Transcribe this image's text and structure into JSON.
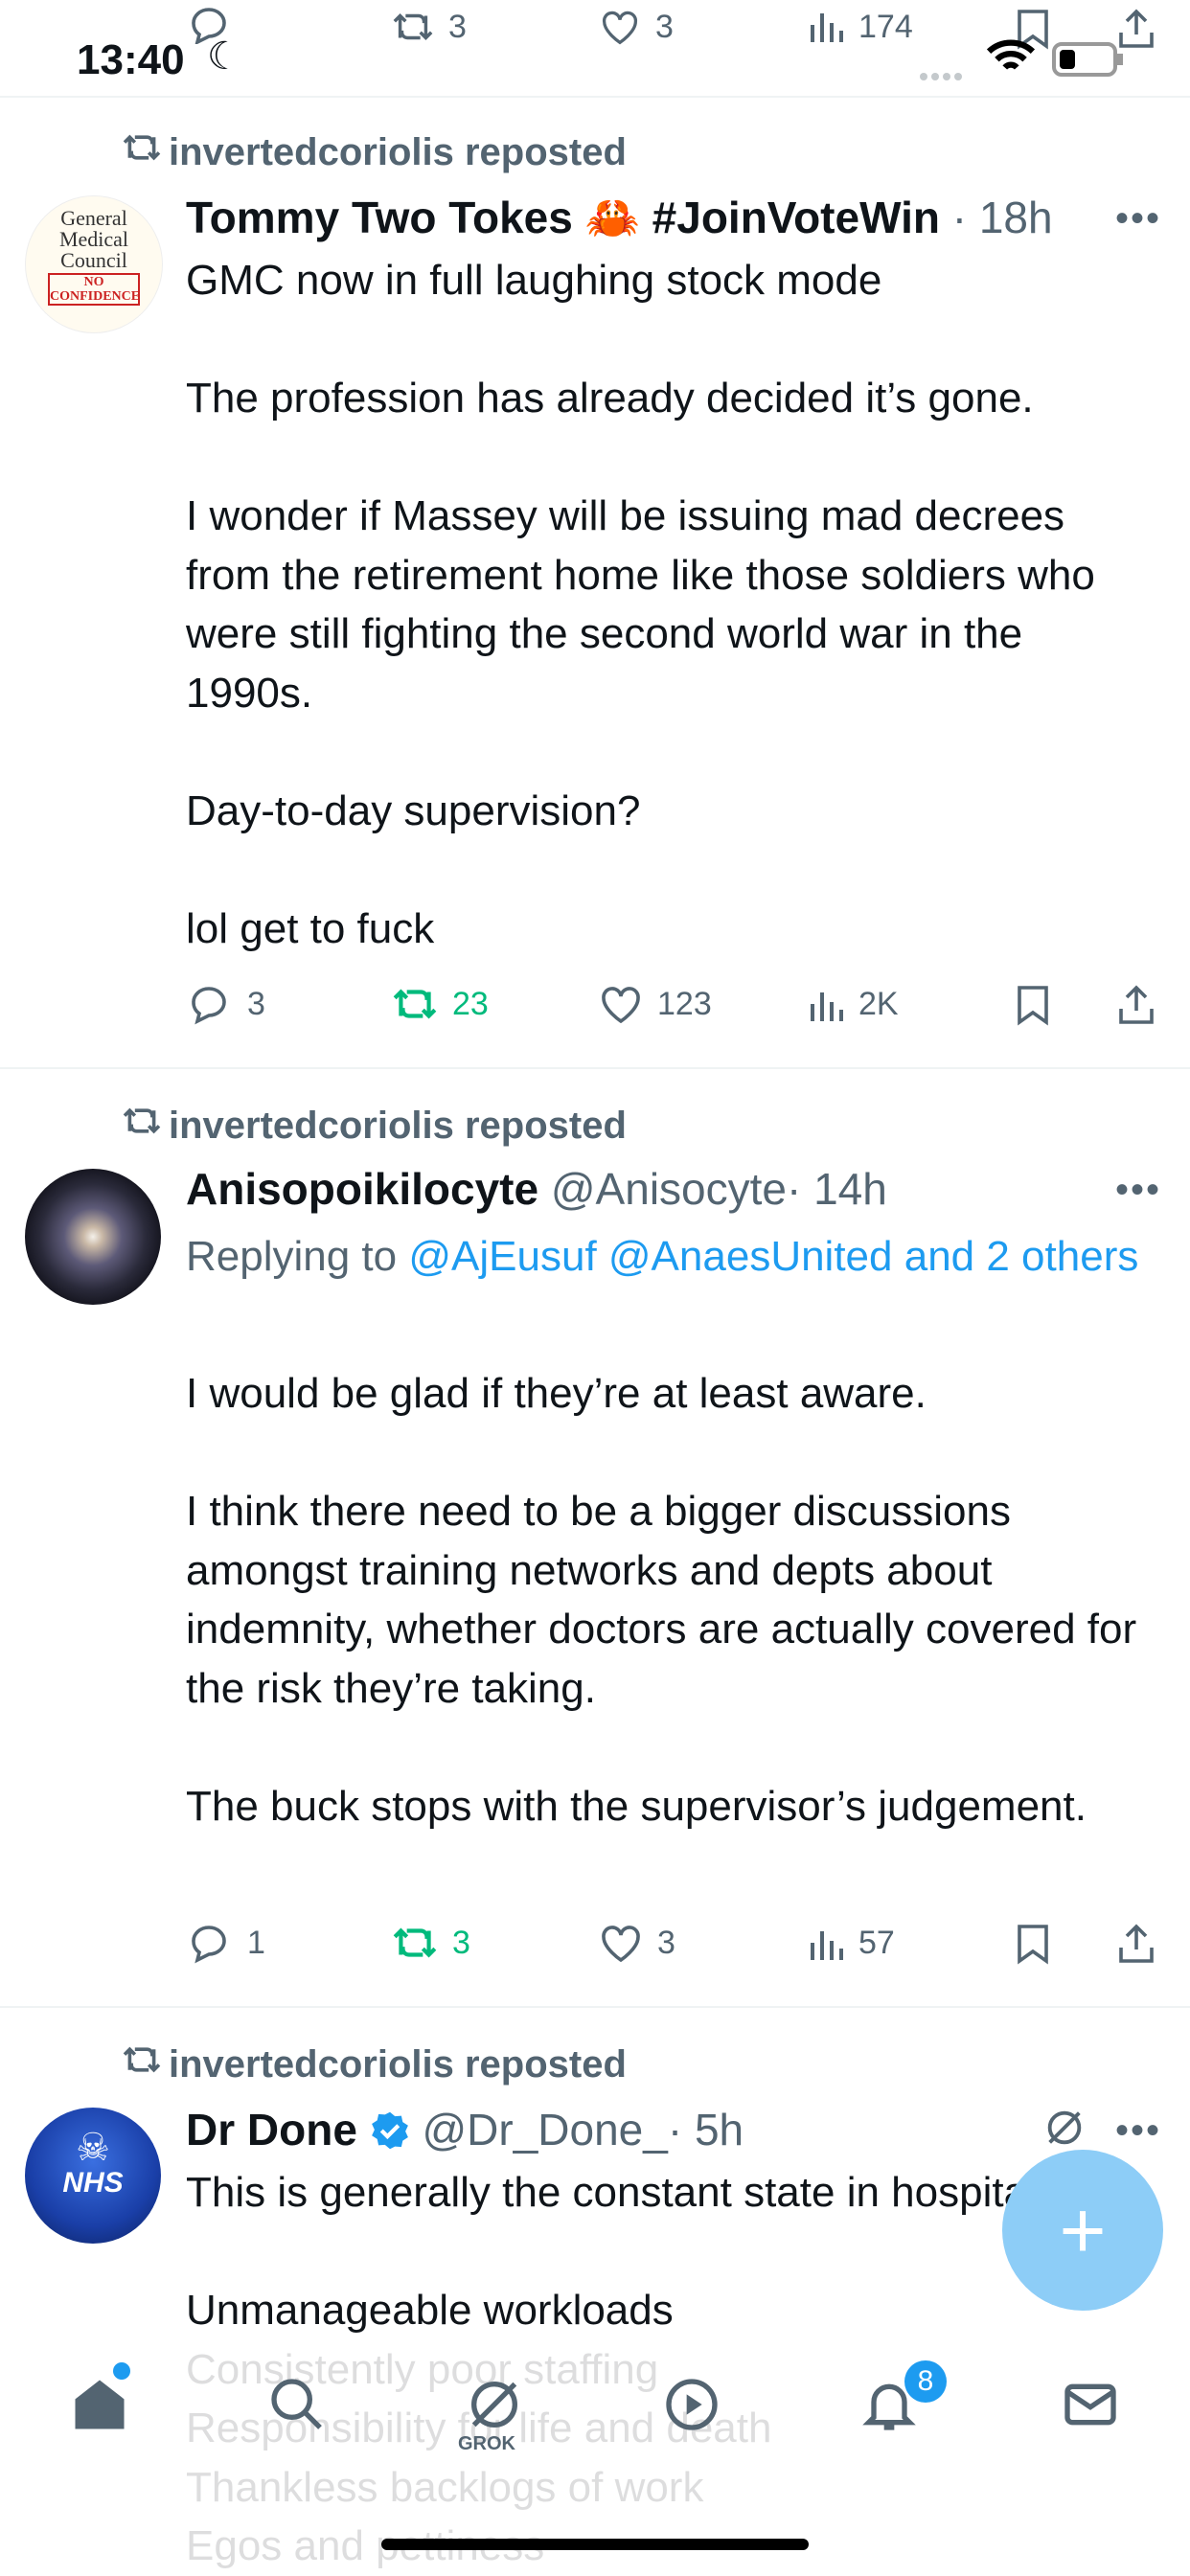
{
  "status": {
    "time": "13:40"
  },
  "prev_tweet_actions": {
    "replies": "",
    "reposts": "3",
    "likes": "3",
    "views": "174"
  },
  "tweets": [
    {
      "reposted_by": "invertedcoriolis reposted",
      "name": "Tommy Two Tokes 🦀 #JoinVoteWin",
      "handle": "",
      "time": "· 18h",
      "avatar_text": [
        "General",
        "Medical",
        "Council",
        "NO",
        "CONFIDENCE"
      ],
      "replying_to": "",
      "body": "GMC now in full laughing stock mode\n\nThe profession has already decided it’s gone.\n\nI wonder if Massey will be issuing mad decrees from the retirement home like those soldiers who were still fighting the second world war in the 1990s.\n\nDay-to-day supervision?\n\nlol get to fuck",
      "replies": "3",
      "reposts": "23",
      "likes": "123",
      "views": "2K"
    },
    {
      "reposted_by": "invertedcoriolis reposted",
      "name": "Anisopoikilocyte",
      "handle": "@Anisocyte",
      "time": "· 14h",
      "replying_prefix": "Replying to ",
      "replying_to": "@AjEusuf @AnaesUnited and 2 others",
      "body": "I would be glad if they’re at least aware.\n\nI think there need to be a bigger discussions amongst training networks and depts about indemnity, whether doctors are actually covered for the risk they’re taking.\n\nThe buck stops with the supervisor’s judgement.",
      "replies": "1",
      "reposts": "3",
      "likes": "3",
      "views": "57"
    },
    {
      "reposted_by": "invertedcoriolis reposted",
      "name": "Dr Done",
      "handle": "@Dr_Done_",
      "time": "· 5h",
      "avatar_text": [
        "NHS"
      ],
      "body": "This is generally the constant state in hospitals\n\nUnmanageable workloads\nConsistently poor staffing\nResponsibility for life and death\nThankless backlogs of work\nEgos and pettiness"
    }
  ],
  "tabbar": {
    "grok_label": "GROK",
    "notifications_badge": "8"
  },
  "colors": {
    "accent": "#1d9bf0",
    "repost_green": "#00ba7c",
    "muted": "#536471",
    "fab": "#8dcdf7"
  }
}
